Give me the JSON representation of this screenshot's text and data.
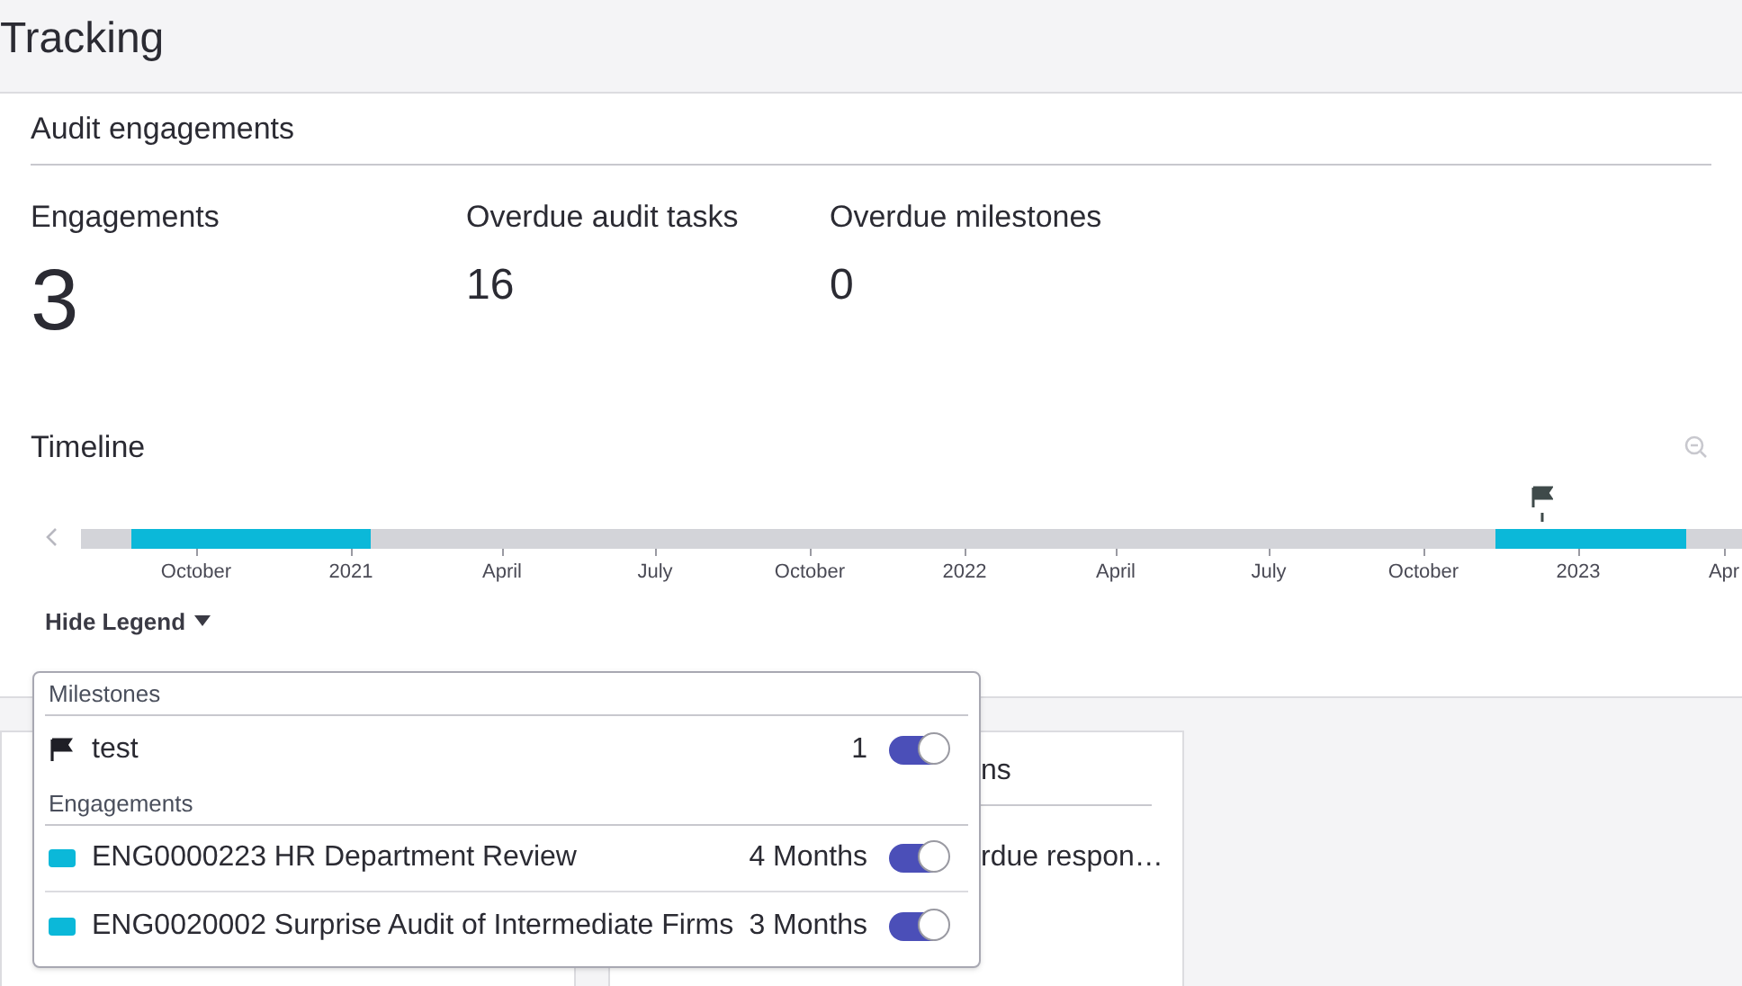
{
  "page_title": "Tracking",
  "card": {
    "title": "Audit engagements",
    "stats": [
      {
        "label": "Engagements",
        "value": "3",
        "kind": "large"
      },
      {
        "label": "Overdue audit tasks",
        "value": "16",
        "kind": "small"
      },
      {
        "label": "Overdue milestones",
        "value": "0",
        "kind": "small"
      }
    ],
    "timeline": {
      "title": "Timeline",
      "months": [
        "October",
        "2021",
        "April",
        "July",
        "October",
        "2022",
        "April",
        "July",
        "October",
        "2023",
        "Apr"
      ],
      "bars": [
        {
          "color": "#0bb8d9"
        },
        {
          "color": "#0bb8d9"
        }
      ],
      "legend_toggle": "Hide Legend",
      "legend_expanded": true
    }
  },
  "legend": {
    "sections": [
      {
        "title": "Milestones",
        "items": [
          {
            "kind": "flag",
            "label": "test",
            "value": "1",
            "on": true
          }
        ]
      },
      {
        "title": "Engagements",
        "items": [
          {
            "kind": "swatch",
            "color": "#0bb8d9",
            "label": "ENG0000223 HR Department Review",
            "value": "4 Months",
            "on": true
          },
          {
            "kind": "swatch",
            "color": "#0bb8d9",
            "label": "ENG0020002 Surprise Audit of Intermediate Firms",
            "value": "3 Months",
            "on": true
          }
        ]
      }
    ]
  },
  "lower_cards": [
    {
      "kind": "plain"
    },
    {
      "kind": "text",
      "heading": "ns",
      "line": "rdue respon…"
    }
  ]
}
